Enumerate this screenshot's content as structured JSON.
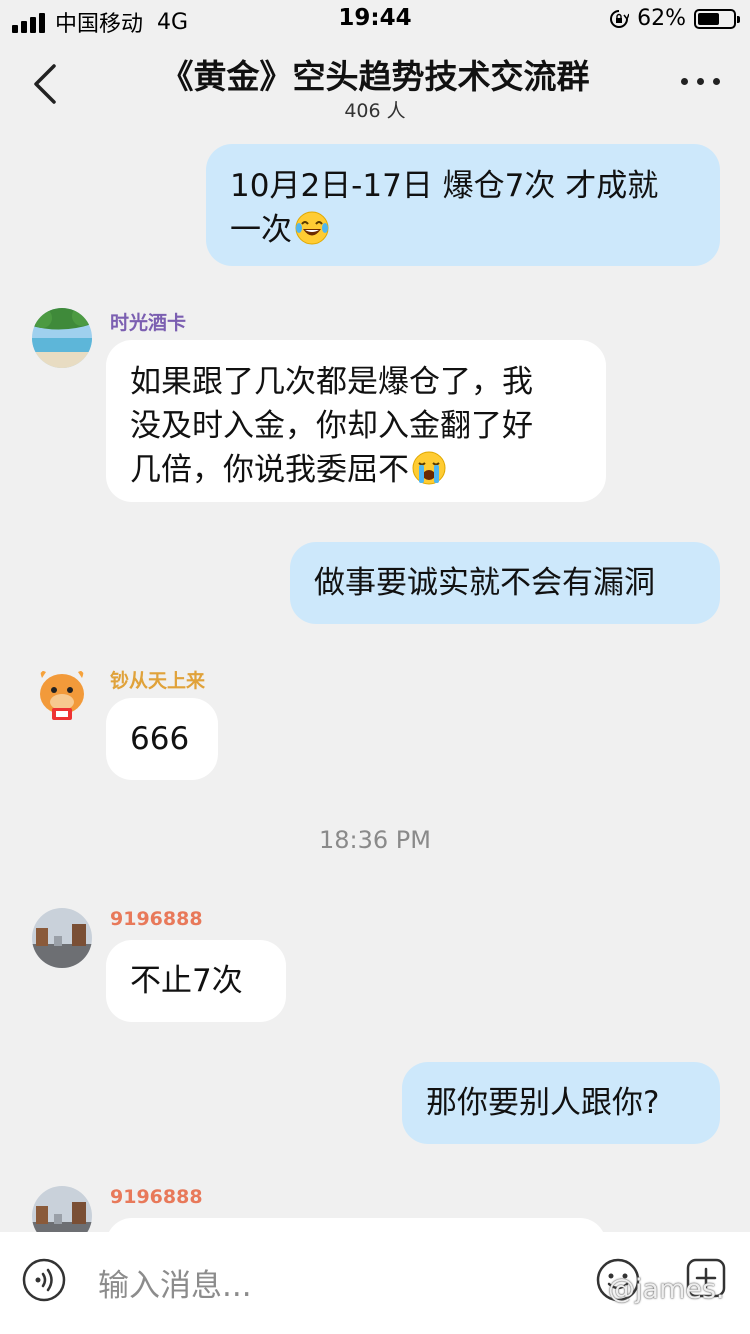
{
  "status_bar": {
    "carrier": "中国移动",
    "network": "4G",
    "time": "19:44",
    "battery_percent": "62%",
    "battery_level": 0.62,
    "icons": [
      "signal-icon",
      "rotation-lock-icon",
      "battery-icon"
    ]
  },
  "header": {
    "title": "《黄金》空头趋势技术交流群",
    "member_count": "406 人",
    "icons": [
      "back-icon",
      "more-icon"
    ]
  },
  "messages": [
    {
      "direction": "outgoing",
      "line1": "10月2日-17日 爆仓7次 才成就",
      "line2": "一次",
      "emoji": "tears-of-joy-emoji"
    },
    {
      "direction": "incoming",
      "sender": "时光酒卡",
      "sender_color": "#7b5fb1",
      "line1": "如果跟了几次都是爆仓了，我",
      "line2": "没及时入金，你却入金翻了好",
      "line3": "几倍，你说我委屈不",
      "emoji": "loudly-crying-emoji"
    },
    {
      "direction": "outgoing",
      "text": "做事要诚实就不会有漏洞"
    },
    {
      "direction": "incoming",
      "sender": "钞从天上来",
      "sender_color": "#e0a23a",
      "text": "666"
    },
    {
      "direction": "incoming",
      "sender": "9196888",
      "sender_color": "#e8795a",
      "text": "不止7次"
    },
    {
      "direction": "outgoing",
      "text": "那你要别人跟你?"
    },
    {
      "direction": "incoming",
      "sender": "9196888",
      "sender_color": "#e8795a",
      "text": ""
    }
  ],
  "time_divider": "18:36 PM",
  "input_bar": {
    "placeholder": "输入消息...",
    "icons": [
      "voice-icon",
      "emoji-icon",
      "add-icon"
    ]
  },
  "watermark": "@james.",
  "colors": {
    "background": "#f0f0f0",
    "outgoing_bubble": "#cde8fb",
    "incoming_bubble": "#ffffff"
  }
}
